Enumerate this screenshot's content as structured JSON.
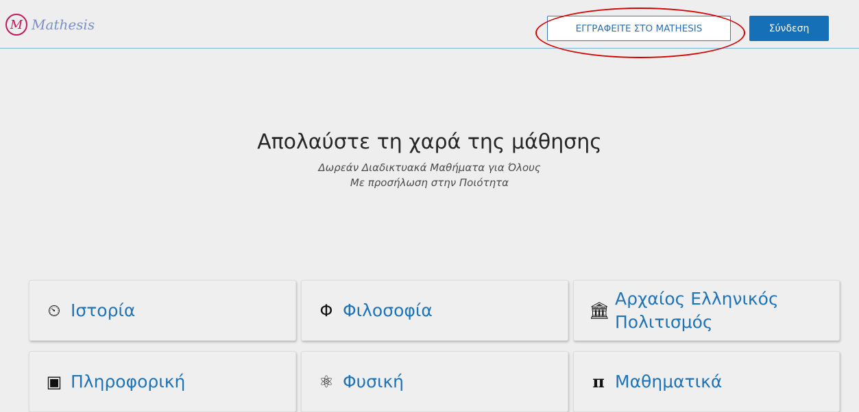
{
  "header": {
    "logo_mark": "M",
    "logo_text": "Mathesis",
    "register_label": "ΕΓΓΡΑΦΕΙΤΕ ΣΤΟ MATHESIS",
    "login_label": "Σύνδεση"
  },
  "hero": {
    "title": "Απολαύστε τη χαρά της μάθησης",
    "subtitle_line1": "Δωρεάν Διαδικτυακά Μαθήματα για Όλους",
    "subtitle_line2": "Με προσήλωση στην Ποιότητα"
  },
  "categories": [
    {
      "label": "Ιστορία",
      "icon": "clock-history-icon",
      "glyph": "⏲"
    },
    {
      "label": "Φιλοσοφία",
      "icon": "phi-icon",
      "glyph": "Φ"
    },
    {
      "label": "Αρχαίος Ελληνικός Πολιτισμός",
      "icon": "ancient-temple-icon",
      "glyph": "🏛"
    },
    {
      "label": "Πληροφορική",
      "icon": "cpu-chip-icon",
      "glyph": "▣"
    },
    {
      "label": "Φυσική",
      "icon": "atom-icon",
      "glyph": "⚛"
    },
    {
      "label": "Μαθηματικά",
      "icon": "pi-icon",
      "glyph": "π"
    }
  ],
  "colors": {
    "brand_blue": "#1670b8",
    "link_blue": "#1f73b7",
    "annotation_red": "#d60000",
    "logo_magenta": "#c2185b"
  }
}
